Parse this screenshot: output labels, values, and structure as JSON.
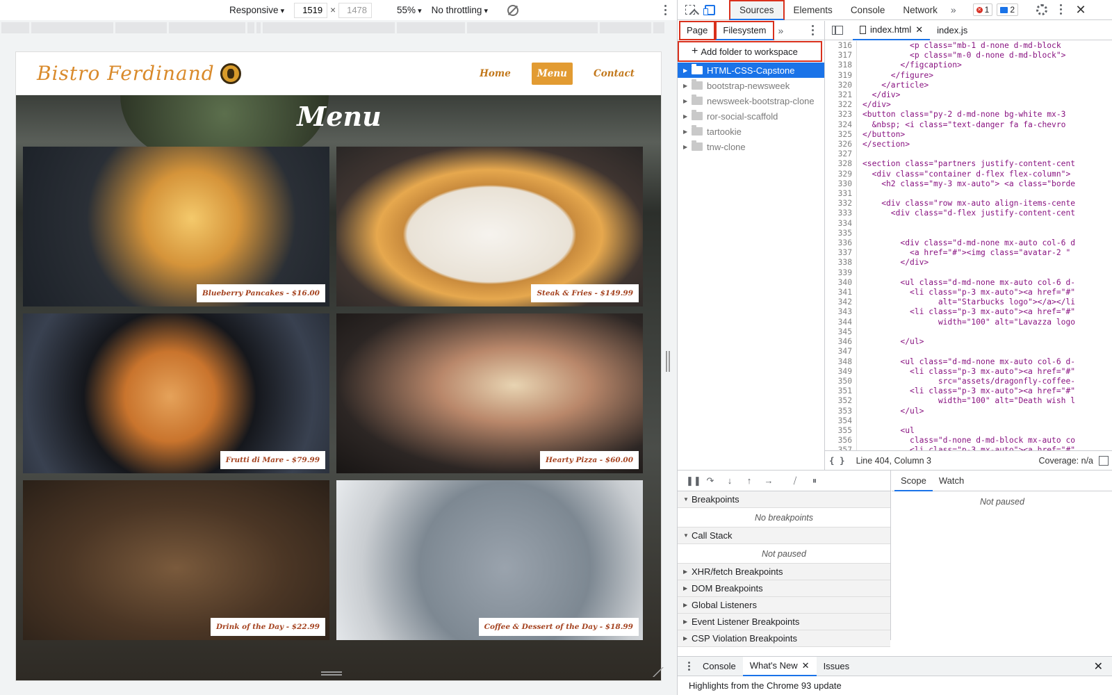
{
  "device_toolbar": {
    "device": "Responsive",
    "width": "1519",
    "times": "×",
    "height": "1478",
    "zoom": "55%",
    "throttling": "No throttling"
  },
  "site": {
    "brand": "Bistro Ferdinand",
    "nav": [
      "Home",
      "Menu",
      "Contact"
    ],
    "active_nav": "Menu",
    "hero_title": "Menu",
    "menu_items": [
      {
        "label": "Blueberry Pancakes - $16.00"
      },
      {
        "label": "Steak & Fries - $149.99"
      },
      {
        "label": "Frutti di Mare - $79.99"
      },
      {
        "label": "Hearty Pizza - $60.00"
      },
      {
        "label": "Drink of the Day - $22.99"
      },
      {
        "label": "Coffee & Dessert of the Day - $18.99"
      }
    ]
  },
  "devtools": {
    "tabs": [
      "Sources",
      "Elements",
      "Console",
      "Network"
    ],
    "active_tab": "Sources",
    "more": "»",
    "error_count": "1",
    "message_count": "2",
    "navigator": {
      "tabs": [
        "Page",
        "Filesystem"
      ],
      "active_tab": "Filesystem",
      "more": "»",
      "add_folder": "Add folder to workspace",
      "folders": [
        "HTML-CSS-Capstone",
        "bootstrap-newsweek",
        "newsweek-bootstrap-clone",
        "ror-social-scaffold",
        "tartookie",
        "tnw-clone"
      ],
      "selected_folder": "HTML-CSS-Capstone"
    },
    "editor": {
      "tabs": [
        "index.html",
        "index.js"
      ],
      "active_tab": "index.html",
      "line_numbers": [
        "316",
        "317",
        "318",
        "319",
        "320",
        "321",
        "322",
        "323",
        "324",
        "325",
        "326",
        "327",
        "328",
        "329",
        "330",
        "331",
        "332",
        "333",
        "334",
        "335",
        "336",
        "337",
        "338",
        "339",
        "340",
        "341",
        "342",
        "343",
        "344",
        "345",
        "346",
        "347",
        "348",
        "349",
        "350",
        "351",
        "352",
        "353",
        "354",
        "355",
        "356",
        "357"
      ],
      "code_lines": [
        "          <p class=\"mb-1 d-none d-md-block",
        "          <p class=\"m-0 d-none d-md-block\">",
        "        </figcaption>",
        "      </figure>",
        "    </article>",
        "  </div>",
        "</div>",
        "<button class=\"py-2 d-md-none bg-white mx-3",
        "  &nbsp; <i class=\"text-danger fa fa-chevro",
        "</button>",
        "</section>",
        "",
        "<section class=\"partners justify-content-cent",
        "  <div class=\"container d-flex flex-column\">",
        "    <h2 class=\"my-3 mx-auto\"> <a class=\"borde",
        "",
        "    <div class=\"row mx-auto align-items-cente",
        "      <div class=\"d-flex justify-content-cent",
        "",
        "",
        "        <div class=\"d-md-none mx-auto col-6 d",
        "          <a href=\"#\"><img class=\"avatar-2 \"",
        "        </div>",
        "",
        "        <ul class=\"d-md-none mx-auto col-6 d-",
        "          <li class=\"p-3 mx-auto\"><a href=\"#\"",
        "                alt=\"Starbucks logo\"></a></li",
        "          <li class=\"p-3 mx-auto\"><a href=\"#\"",
        "                width=\"100\" alt=\"Lavazza logo",
        "",
        "        </ul>",
        "",
        "        <ul class=\"d-md-none mx-auto col-6 d-",
        "          <li class=\"p-3 mx-auto\"><a href=\"#\"",
        "                src=\"assets/dragonfly-coffee-",
        "          <li class=\"p-3 mx-auto\"><a href=\"#\"",
        "                width=\"100\" alt=\"Death wish l",
        "        </ul>",
        "",
        "        <ul",
        "          class=\"d-none d-md-block mx-auto co",
        "          <li class=\"p-3 mx-auto\"><a href=\"#\""
      ],
      "status": "Line 404, Column 3",
      "coverage": "Coverage: n/a"
    },
    "debugger": {
      "sections": [
        {
          "title": "Breakpoints",
          "open": true,
          "body": "No breakpoints"
        },
        {
          "title": "Call Stack",
          "open": true,
          "body": "Not paused"
        },
        {
          "title": "XHR/fetch Breakpoints",
          "open": false
        },
        {
          "title": "DOM Breakpoints",
          "open": false
        },
        {
          "title": "Global Listeners",
          "open": false
        },
        {
          "title": "Event Listener Breakpoints",
          "open": false
        },
        {
          "title": "CSP Violation Breakpoints",
          "open": false
        }
      ],
      "side_tabs": [
        "Scope",
        "Watch"
      ],
      "active_side_tab": "Scope",
      "side_body": "Not paused"
    },
    "drawer": {
      "tabs": [
        "Console",
        "What's New",
        "Issues"
      ],
      "active_tab": "What's New",
      "body": "Highlights from the Chrome 93 update"
    }
  },
  "colors": {
    "accent_blue": "#1a73e8",
    "highlight_red": "#d9301c",
    "brand_orange": "#e29b32",
    "label_red": "#a4421f"
  }
}
